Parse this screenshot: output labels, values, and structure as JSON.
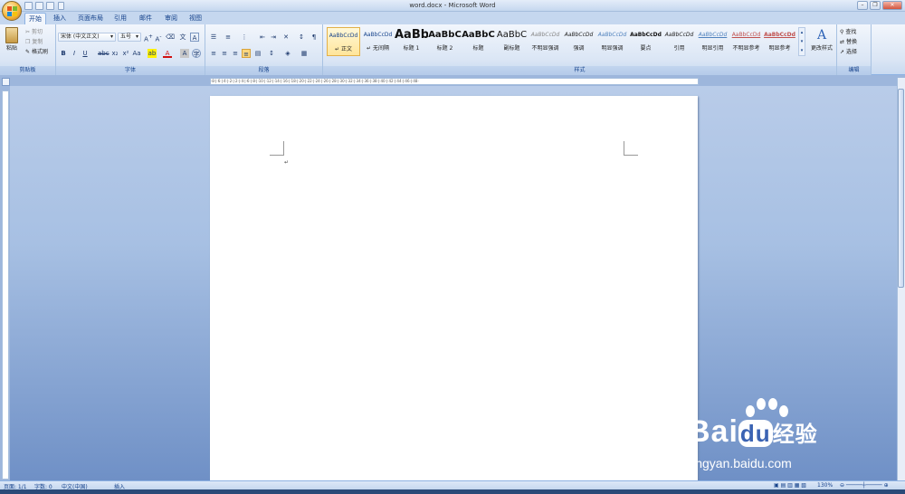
{
  "window": {
    "title": "word.docx - Microsoft Word"
  },
  "tabs": [
    "开始",
    "插入",
    "页面布局",
    "引用",
    "邮件",
    "审阅",
    "视图"
  ],
  "clipboard": {
    "paste": "粘贴",
    "cut": "剪切",
    "copy": "复制",
    "format_painter": "格式刷",
    "label": "剪贴板"
  },
  "font": {
    "family": "宋体 (中文正文)",
    "size": "五号",
    "label": "字体"
  },
  "paragraph": {
    "label": "段落"
  },
  "styles": {
    "items": [
      {
        "preview": "AaBbCcDd",
        "name": "↵ 正文"
      },
      {
        "preview": "AaBbCcDd",
        "name": "↵ 无间隔"
      },
      {
        "preview": "AaBb",
        "name": "标题 1"
      },
      {
        "preview": "AaBbC",
        "name": "标题 2"
      },
      {
        "preview": "AaBbC",
        "name": "标题"
      },
      {
        "preview": "AaBbC",
        "name": "副标题"
      },
      {
        "preview": "AaBbCcDd",
        "name": "不明显强调"
      },
      {
        "preview": "AaBbCcDd",
        "name": "强调"
      },
      {
        "preview": "AaBbCcDd",
        "name": "明显强调"
      },
      {
        "preview": "AaBbCcDd",
        "name": "要点"
      },
      {
        "preview": "AaBbCcDd",
        "name": "引用"
      },
      {
        "preview": "AaBbCcDd",
        "name": "明显引用"
      },
      {
        "preview": "AaBbCcDd",
        "name": "不明显参考"
      },
      {
        "preview": "AaBbCcDd",
        "name": "明显参考"
      }
    ],
    "change_styles": "更改样式",
    "label": "样式"
  },
  "editing": {
    "find": "查找",
    "replace": "替换",
    "select": "选择",
    "label": "编辑"
  },
  "ruler": {
    "ticks": "·8·|·6·|·4·|·2·|·2·|·4·|·6·|·8·|·10·|·12·|·14·|·16·|·18·|·20·|·22·|·24·|·26·|·28·|·30·|·32·|·34·|·36·|·38·|·40·|·42·|·44·|·46·|·48·"
  },
  "document": {
    "paragraph_mark": "↵"
  },
  "status": {
    "page": "页面: 1/1",
    "words": "字数: 0",
    "language": "中文(中国)",
    "mode": "插入",
    "zoom": "130%"
  },
  "watermark": {
    "brand": "Bai",
    "brand_end": "du",
    "suffix": "经验",
    "url": "jingyan.baidu.com"
  }
}
